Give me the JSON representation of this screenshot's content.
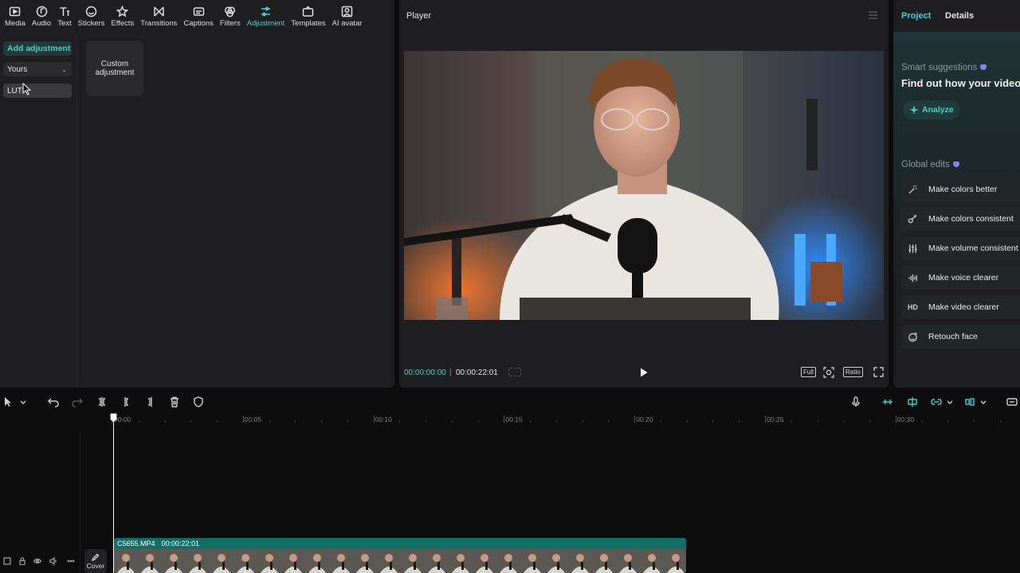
{
  "toolbar": {
    "tools": [
      {
        "label": "Media",
        "icon": "media-icon"
      },
      {
        "label": "Audio",
        "icon": "audio-icon"
      },
      {
        "label": "Text",
        "icon": "text-icon"
      },
      {
        "label": "Stickers",
        "icon": "stickers-icon"
      },
      {
        "label": "Effects",
        "icon": "effects-icon"
      },
      {
        "label": "Transitions",
        "icon": "transitions-icon"
      },
      {
        "label": "Captions",
        "icon": "captions-icon"
      },
      {
        "label": "Filters",
        "icon": "filters-icon"
      },
      {
        "label": "Adjustment",
        "icon": "adjustment-icon",
        "active": true
      },
      {
        "label": "Templates",
        "icon": "templates-icon"
      },
      {
        "label": "AI avatar",
        "icon": "ai-avatar-icon"
      }
    ]
  },
  "adjust_panel": {
    "add_button": "Add adjustment",
    "dropdown_value": "Yours",
    "lut_label": "LUT",
    "custom_card": "Custom adjustment"
  },
  "player": {
    "title": "Player",
    "current_time": "00:00:00:00",
    "separator": "|",
    "duration": "00:00:22:01",
    "full_label": "Full",
    "ratio_label": "Ratio"
  },
  "right_panel": {
    "tabs": [
      "Project",
      "Details"
    ],
    "smart_label": "Smart suggestions",
    "smart_text": "Find out how your video",
    "analyze_label": "Analyze",
    "global_label": "Global edits",
    "global_items": [
      {
        "label": "Make colors better",
        "icon": "magic-wand-icon"
      },
      {
        "label": "Make colors consistent",
        "icon": "color-match-icon"
      },
      {
        "label": "Make volume consistent",
        "icon": "volume-sliders-icon"
      },
      {
        "label": "Make voice clearer",
        "icon": "voice-wave-icon"
      },
      {
        "label": "Make video clearer",
        "icon": "hd-icon",
        "icon_text": "HD"
      },
      {
        "label": "Retouch face",
        "icon": "retouch-face-icon"
      }
    ]
  },
  "timeline": {
    "ticks": [
      "00:00",
      "00:05",
      "00:10",
      "00:15",
      "00:20",
      "00:25",
      "00:30"
    ],
    "clip_name": "C5655.MP4",
    "clip_duration": "00:00:22:01",
    "cover_label": "Cover"
  },
  "colors": {
    "accent": "#3fd3c8",
    "panel": "#1e1e20",
    "background": "#0d0d0e",
    "clip_header": "#0f6f67"
  }
}
